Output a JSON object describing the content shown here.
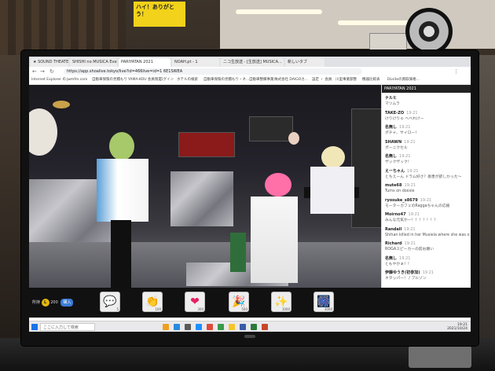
{
  "shop": {
    "sign_text": "ハイ！ありがとう！"
  },
  "browser": {
    "tabs": [
      {
        "label": "★ SOUND THEATER"
      },
      {
        "label": "SHISHI no MUSICA Event"
      },
      {
        "label": "PARIYATAN 2021"
      },
      {
        "label": "NOAH.pt - 1"
      },
      {
        "label": "ニコ生放送 - [生放送] MUSICA..."
      },
      {
        "label": "新しいタブ"
      }
    ],
    "url": "https://app.shoalive.tokyo/live?id=466live=id=1 6E1SWEA",
    "bookmarks": [
      "Internet Explorer の",
      "jwmfm.com",
      "自動車保険の見積もり",
      "YAMA-KOU 会員限定",
      "ログイン",
      "ホテルの検索",
      "自動車保険の見積もり・ネ...",
      "自動車整備事業",
      "株式会社 DAIGOカ...",
      "設定 ・ 会員",
      "川里事業部整",
      "機器比較表",
      "DLsiteの買取価格…"
    ]
  },
  "chat": {
    "title": "PARIYATAN 2021",
    "messages": [
      {
        "name": "ナルヒ",
        "time": "",
        "text": "マツムラ"
      },
      {
        "name": "TAKE-ZO",
        "time": "19:21",
        "text": "けりけりゃ へべれけー"
      },
      {
        "name": "名無し",
        "time": "19:21",
        "text": "ポチャ、サイロー！"
      },
      {
        "name": "SHAWN",
        "time": "19:21",
        "text": "ポーニクセル"
      },
      {
        "name": "名無し",
        "time": "19:21",
        "text": "ザックザック！"
      },
      {
        "name": "えーちゃん",
        "time": "19:21",
        "text": "とちえーん ドラム好さ？恩恵が欲しかった～"
      },
      {
        "name": "mute68",
        "time": "19:21",
        "text": "Turns on doxxie"
      },
      {
        "name": "ryosuke_s8679",
        "time": "19:21",
        "text": "モーターカフェのRaggaちゃんの応援"
      },
      {
        "name": "Moirno47",
        "time": "19:21",
        "text": "みんな元気かー！！！！！！！"
      },
      {
        "name": "Randall",
        "time": "19:21",
        "text": "Shihan killed in her Musiela where she was on maternity"
      },
      {
        "name": "Richard",
        "time": "19:21",
        "text": "ROGAスピーカーの前お願い"
      },
      {
        "name": "名無し",
        "time": "19:21",
        "text": "ともやかぁ！！"
      },
      {
        "name": "伊藤ゆうき(初参加)",
        "time": "19:21",
        "text": "ネタッパー！ / ブルゾン"
      }
    ]
  },
  "controls": {
    "coin_label": "所持",
    "coin_symbol": "L",
    "coin_amount": "200",
    "buy_label": "購入",
    "gifts": [
      {
        "icon": "💬",
        "value": "5"
      },
      {
        "icon": "👏",
        "value": "100"
      },
      {
        "icon": "❤",
        "value": "300"
      },
      {
        "icon": "🎉",
        "value": "500"
      },
      {
        "icon": "✨",
        "value": "1000"
      },
      {
        "icon": "🎆",
        "value": "3000"
      }
    ]
  },
  "taskbar": {
    "search_placeholder": "ここに入力して検索",
    "time": "19:21",
    "date": "2021/10/24"
  },
  "colors": {
    "coin": "#e3b80e",
    "buy": "#3a7bd5",
    "pink_hair": "#ff6fa8",
    "green_hair": "#a7c96a"
  }
}
